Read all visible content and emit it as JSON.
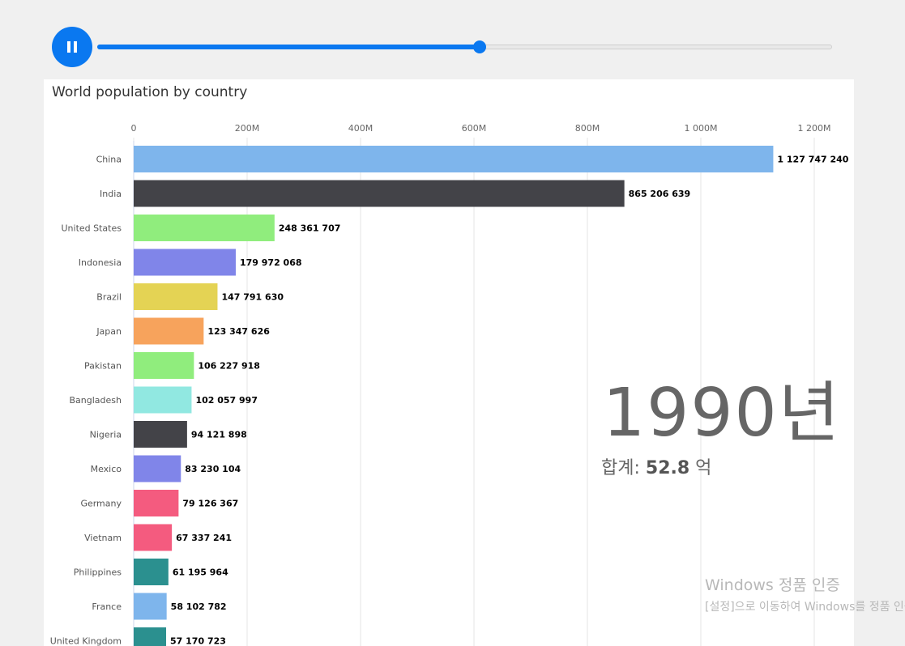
{
  "controls": {
    "progress": 0.52
  },
  "chart_data": {
    "type": "bar",
    "orientation": "horizontal",
    "title": "World population by country",
    "xlim": [
      0,
      1250000000
    ],
    "ticks": [
      {
        "value": 0,
        "label": "0"
      },
      {
        "value": 200000000,
        "label": "200M"
      },
      {
        "value": 400000000,
        "label": "400M"
      },
      {
        "value": 600000000,
        "label": "600M"
      },
      {
        "value": 800000000,
        "label": "800M"
      },
      {
        "value": 1000000000,
        "label": "1 000M"
      },
      {
        "value": 1200000000,
        "label": "1 200M"
      }
    ],
    "grid": true,
    "categories": [
      "China",
      "India",
      "United States",
      "Indonesia",
      "Brazil",
      "Japan",
      "Pakistan",
      "Bangladesh",
      "Nigeria",
      "Mexico",
      "Germany",
      "Vietnam",
      "Philippines",
      "France",
      "United Kingdom"
    ],
    "values": [
      1127747240,
      865206639,
      248361707,
      179972068,
      147791630,
      123347626,
      106227918,
      102057997,
      94121898,
      83230104,
      79126367,
      67337241,
      61195964,
      58102782,
      57170723
    ],
    "value_labels": [
      "1 127 747 240",
      "865 206 639",
      "248 361 707",
      "179 972 068",
      "147 791 630",
      "123 347 626",
      "106 227 918",
      "102 057 997",
      "94 121 898",
      "83 230 104",
      "79 126 367",
      "67 337 241",
      "61 195 964",
      "58 102 782",
      "57 170 723"
    ],
    "colors": [
      "#7eb5ec",
      "#434348",
      "#90ed7d",
      "#8085e9",
      "#e4d354",
      "#f7a35c",
      "#90ed7d",
      "#91e8e1",
      "#434348",
      "#8085e9",
      "#f45b7f",
      "#f45b7f",
      "#2b908f",
      "#7eb5ec",
      "#2b908f"
    ],
    "year_label": "1990년",
    "total_prefix": "합계: ",
    "total_value": "52.8",
    "total_unit": " 억"
  },
  "watermark": {
    "line1": "Windows 정품 인증",
    "line2": "[설정]으로 이동하여 Windows를 정품 인증합니다."
  }
}
